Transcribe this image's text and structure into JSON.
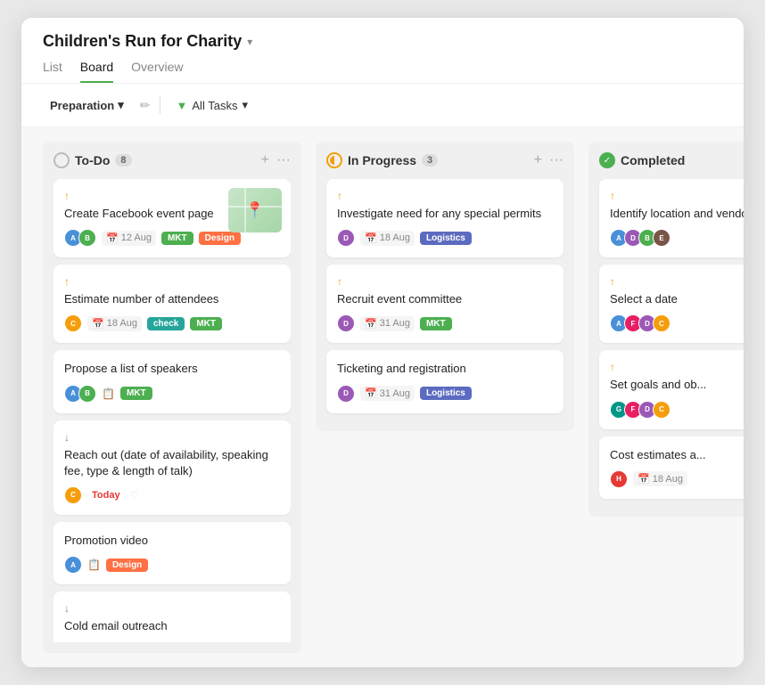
{
  "header": {
    "title": "Children's Run for Charity",
    "dropdown_icon": "▾",
    "tabs": [
      {
        "label": "List",
        "active": false
      },
      {
        "label": "Board",
        "active": true
      },
      {
        "label": "Overview",
        "active": false
      }
    ]
  },
  "toolbar": {
    "section_label": "Preparation",
    "section_dropdown": "▾",
    "filter_label": "All Tasks",
    "filter_dropdown": "▾"
  },
  "columns": {
    "todo": {
      "title": "To-Do",
      "count": "8",
      "add_label": "+",
      "more_label": "···"
    },
    "inprogress": {
      "title": "In Progress",
      "count": "3",
      "add_label": "+",
      "more_label": "···"
    },
    "completed": {
      "title": "Completed",
      "add_label": "+",
      "more_label": "···"
    }
  },
  "todo_cards": [
    {
      "id": "card-1",
      "title": "Create Facebook event page",
      "priority": "up",
      "date": "12 Aug",
      "tags": [
        "MKT",
        "Design"
      ],
      "has_map": true,
      "avatars": [
        "blue",
        "green"
      ]
    },
    {
      "id": "card-2",
      "title": "Estimate number of attendees",
      "priority": "up",
      "date": "18 Aug",
      "tags": [
        "check",
        "MKT"
      ],
      "avatars": [
        "orange"
      ]
    },
    {
      "id": "card-3",
      "title": "Propose a list of speakers",
      "priority": null,
      "date": null,
      "tags": [
        "MKT"
      ],
      "avatars": [
        "blue",
        "green"
      ],
      "has_attach": true
    },
    {
      "id": "card-4",
      "title": "Reach out (date of availability, speaking fee, type & length of talk)",
      "priority": "down",
      "date": "Today",
      "date_type": "today",
      "tags": [],
      "avatars": [
        "orange"
      ],
      "has_heart": true
    },
    {
      "id": "card-5",
      "title": "Promotion video",
      "priority": null,
      "date": null,
      "tags": [
        "Design"
      ],
      "avatars": [
        "blue"
      ],
      "has_attach": true
    },
    {
      "id": "card-6",
      "title": "Cold email outreach",
      "priority": "down",
      "date": null,
      "tags": [],
      "avatars": [
        "blue",
        "green"
      ]
    }
  ],
  "inprogress_cards": [
    {
      "id": "ip-1",
      "title": "Investigate need for any special permits",
      "priority": "up",
      "date": "18 Aug",
      "tags": [
        "Logistics"
      ],
      "avatars": [
        "purple"
      ]
    },
    {
      "id": "ip-2",
      "title": "Recruit event committee",
      "priority": "up",
      "date": "31 Aug",
      "tags": [
        "MKT"
      ],
      "avatars": [
        "purple"
      ]
    },
    {
      "id": "ip-3",
      "title": "Ticketing and registration",
      "priority": null,
      "date": "31 Aug",
      "tags": [
        "Logistics"
      ],
      "avatars": [
        "purple"
      ]
    }
  ],
  "completed_cards": [
    {
      "id": "c-1",
      "title": "Identify location and vendors",
      "priority": "up",
      "avatars": [
        "blue",
        "purple",
        "green",
        "brown"
      ]
    },
    {
      "id": "c-2",
      "title": "Select a date",
      "priority": "up",
      "avatars": [
        "blue",
        "pink",
        "purple",
        "orange"
      ]
    },
    {
      "id": "c-3",
      "title": "Set goals and ob...",
      "priority": "up",
      "avatars": [
        "teal",
        "pink",
        "purple",
        "orange"
      ]
    },
    {
      "id": "c-4",
      "title": "Cost estimates a...",
      "priority": null,
      "date": "18 Aug",
      "avatars": [
        "red"
      ]
    }
  ],
  "icons": {
    "calendar": "📅",
    "filter": "⧩",
    "edit": "✏️",
    "plus": "+",
    "more": "···",
    "attach": "📎",
    "heart": "♡",
    "map_pin": "📍",
    "chevron_down": "▾"
  }
}
